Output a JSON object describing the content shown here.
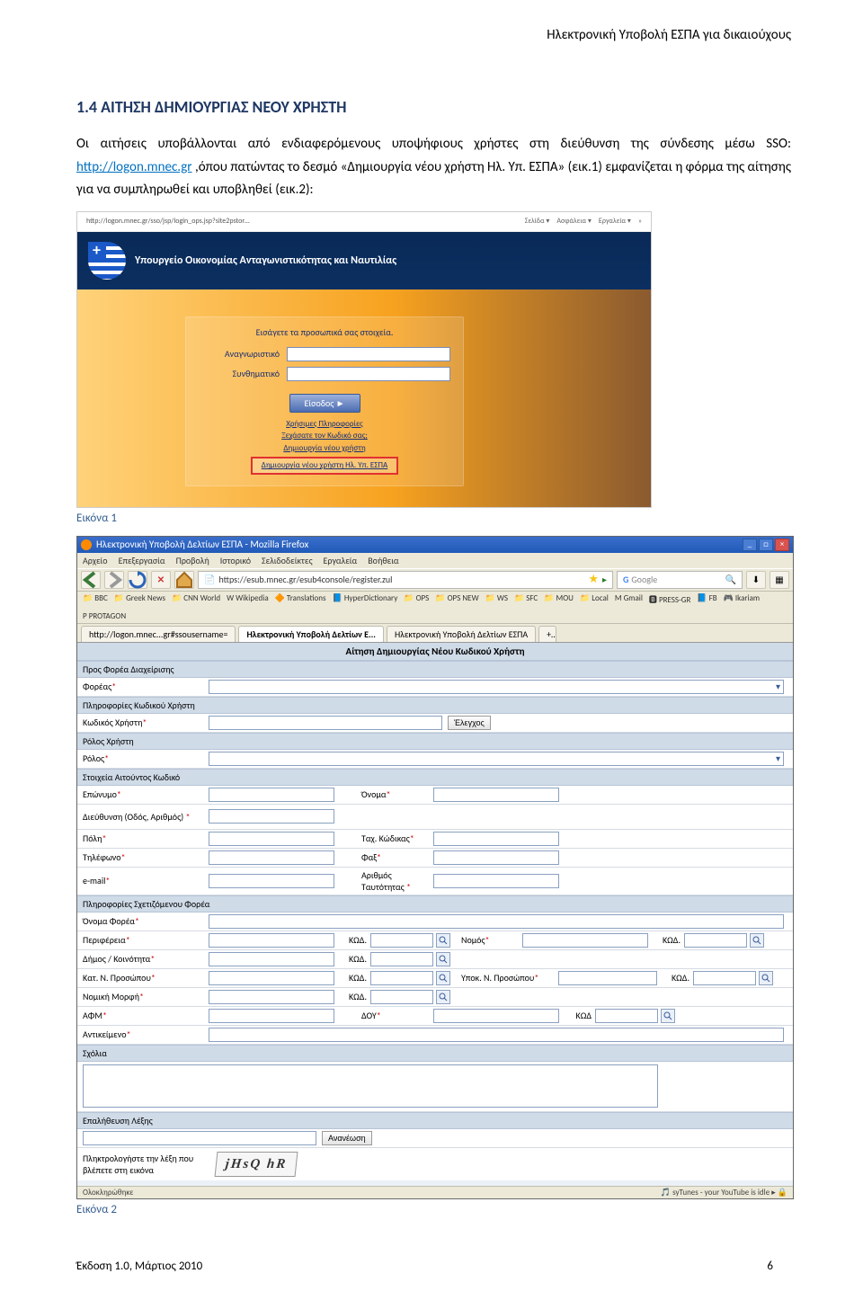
{
  "header": {
    "right_title": "Ηλεκτρονική Υποβολή ΕΣΠΑ για δικαιούχους"
  },
  "section": {
    "title": "1.4  ΑΙΤΗΣΗ ΔΗΜΙΟΥΡΓΙΑΣ ΝΕΟΥ ΧΡΗΣΤΗ"
  },
  "body": {
    "para1_a": "Οι αιτήσεις υποβάλλονται από ενδιαφερόμενους υποψήφιους χρήστες στη διεύθυνση της σύνδεσης μέσω SSO: ",
    "link_text": "http://logon.mnec.gr",
    "para1_b": " ,όπου πατώντας το δεσμό «Δημιουργία νέου χρήστη Ηλ. Υπ. ΕΣΠΑ» (εικ.1) εμφανίζεται η φόρμα της αίτησης για να συμπληρωθεί και υποβληθεί (εικ.2):"
  },
  "fig1": {
    "caption": "Εικόνα 1"
  },
  "fig2": {
    "caption": "Εικόνα 2"
  },
  "shot1": {
    "url": "http://logon.mnec.gr/sso/jsp/login_ops.jsp?site2pstor…",
    "top_links": [
      "Σελίδα ▾",
      "Ασφάλεια ▾",
      "Εργαλεία ▾"
    ],
    "banner": "Υπουργείο Οικονομίας Ανταγωνιστικότητας και Ναυτιλίας",
    "panel_hdr": "Εισάγετε τα προσωπικά σας στοιχεία.",
    "lbl_user": "Αναγνωριστικό",
    "lbl_pass": "Συνθηματικό",
    "btn": "Είσοδος ►",
    "link1": "Χρήσιμες Πληροφορίες",
    "link2": "Ξεχάσατε τον Κωδικό σας;",
    "link3": "Δημιουργία νέου χρήστη",
    "link4": "Δημιουργία νέου χρήστη Ηλ. Υπ. ΕΣΠΑ"
  },
  "shot2": {
    "win_title": "Ηλεκτρονική Υποβολή Δελτίων ΕΣΠΑ - Mozilla Firefox",
    "menus": [
      "Αρχείο",
      "Επεξεργασία",
      "Προβολή",
      "Ιστορικό",
      "Σελιδοδείκτες",
      "Εργαλεία",
      "Βοήθεια"
    ],
    "url": "https://esub.mnec.gr/esub4console/register.zul",
    "search_placeholder": "Google",
    "bookmarks": [
      "BBC",
      "Greek News",
      "CNN World",
      "Wikipedia",
      "Translations",
      "HyperDictionary",
      "OPS",
      "OPS NEW",
      "WS",
      "SFC",
      "MOU",
      "Local",
      "Gmail",
      "PRESS-GR",
      "FB",
      "Ikariam",
      "PROTAGON"
    ],
    "tabs": [
      "http://logon.mnec...gr#ssousername=",
      "Ηλεκτρονική Υποβολή Δελτίων Ε...",
      "Ηλεκτρονική Υποβολή Δελτίων ΕΣΠΑ"
    ],
    "form_title": "Αίτηση Δημιουργίας Νέου Κωδικού Χρήστη",
    "labels": {
      "sec_a": "Προς Φορέα Διαχείρισης",
      "foreas": "Φορέας",
      "sec_b": "Πληροφορίες Κωδικού Χρήστη",
      "kodikos": "Κωδικός Χρήστη",
      "btn_elegxos": "Έλεγχος",
      "sec_role": "Ρόλος Χρήστη",
      "rolos": "Ρόλος",
      "sec_c": "Στοιχεία Αιτούντος Κωδικό",
      "eponymo": "Επώνυμο",
      "onoma": "Όνομα",
      "dieu": "Διεύθυνση (Οδός, Αριθμός)",
      "poli": "Πόλη",
      "tk": "Ταχ. Κώδικας",
      "tel": "Τηλέφωνο",
      "fax": "Φαξ",
      "email": "e-mail",
      "arith": "Αριθμός Ταυτότητας",
      "sec_d": "Πληροφορίες Σχετιζόμενου Φορέα",
      "onoma_forea": "Όνομα Φορέα",
      "perif": "Περιφέρεια",
      "nomos": "Νομός",
      "dimos": "Δήμος / Κοινότητα",
      "katn": "Κατ. Ν. Προσώπου",
      "ypok": "Υποκ. Ν. Προσώπου",
      "nomiki": "Νομική Μορφή",
      "afm": "ΑΦΜ",
      "doy": "ΔΟΥ",
      "antik": "Αντικείμενο",
      "sec_sxolia": "Σχόλια",
      "sec_captcha": "Επαλήθευση Λέξης",
      "captcha_hint": "Πληκτρολογήστε την λέξη που βλέπετε στη εικόνα",
      "btn_refresh": "Ανανέωση",
      "kod": "ΚΩΔ.",
      "kod2": "ΚΩΔ"
    },
    "captcha_text": "jHsQ hR",
    "status_left": "Ολοκληρώθηκε",
    "status_right": "syTunes - your YouTube is idle"
  },
  "footer": {
    "left": "Έκδοση 1.0, Μάρτιος 2010",
    "page": "6"
  }
}
